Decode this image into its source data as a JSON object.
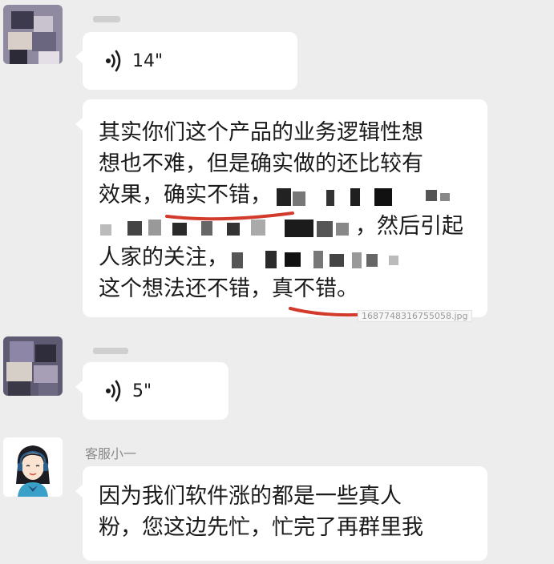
{
  "chat": {
    "messages": [
      {
        "sender": "",
        "kind": "voice",
        "duration": "14\""
      },
      {
        "sender": "",
        "kind": "text",
        "lines": [
          "其实你们这个产品的业务逻辑性想",
          "想也不难，但是确实做的还比较有",
          "效果，确实不错，",
          "，然后引起",
          "人家的关注，",
          "这个想法还不错，真不错。"
        ],
        "attachment_filename": "1687748316755058.jpg"
      },
      {
        "sender": "",
        "kind": "voice",
        "duration": "5\""
      },
      {
        "sender": "客服小一",
        "kind": "text",
        "lines": [
          "因为我们软件涨的都是一些真人",
          "粉，您这边先忙，忙完了再群里我"
        ]
      }
    ]
  },
  "icons": {
    "voice": "voice-wave-icon",
    "avatar_user": "pixelated-avatar",
    "avatar_agent": "customer-service-agent-avatar"
  },
  "colors": {
    "background": "#ededed",
    "bubble": "#ffffff",
    "underline": "#d23a2b",
    "sender_name": "#8a8a8a"
  }
}
